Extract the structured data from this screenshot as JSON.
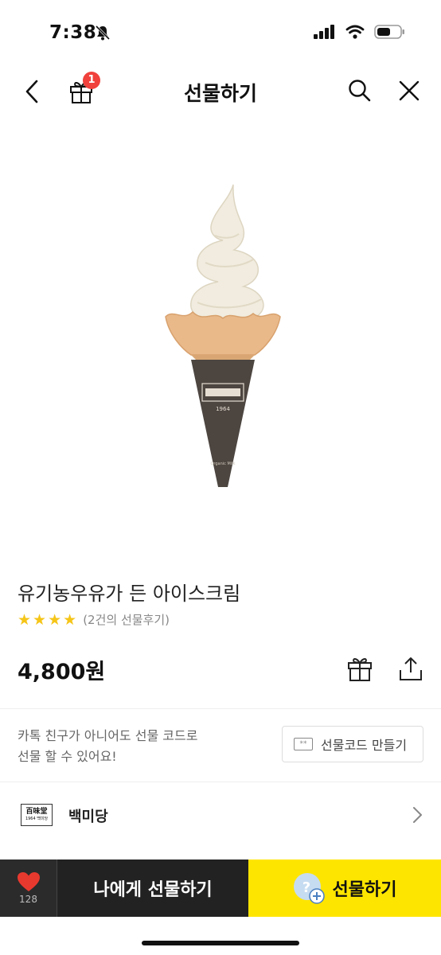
{
  "status": {
    "time": "7:38"
  },
  "header": {
    "title": "선물하기",
    "gift_badge": "1"
  },
  "product": {
    "name": "유기농우유가 든 아이스크림",
    "stars": 4,
    "review_text": "(2건의 선물후기)",
    "price": "4,800원"
  },
  "gift_code": {
    "message_line1": "카톡 친구가 아니어도 선물 코드로",
    "message_line2": "선물 할 수 있어요!",
    "button_label": "선물코드 만들기"
  },
  "brand": {
    "name": "백미당",
    "logo_text": "百味堂",
    "logo_sub": "1964 백미당"
  },
  "bottom_bar": {
    "like_count": "128",
    "self_gift_label": "나에게 선물하기",
    "gift_label": "선물하기"
  },
  "colors": {
    "accent": "#fee500",
    "dark": "#222222",
    "badge": "#f0413c",
    "star": "#f5c518"
  }
}
